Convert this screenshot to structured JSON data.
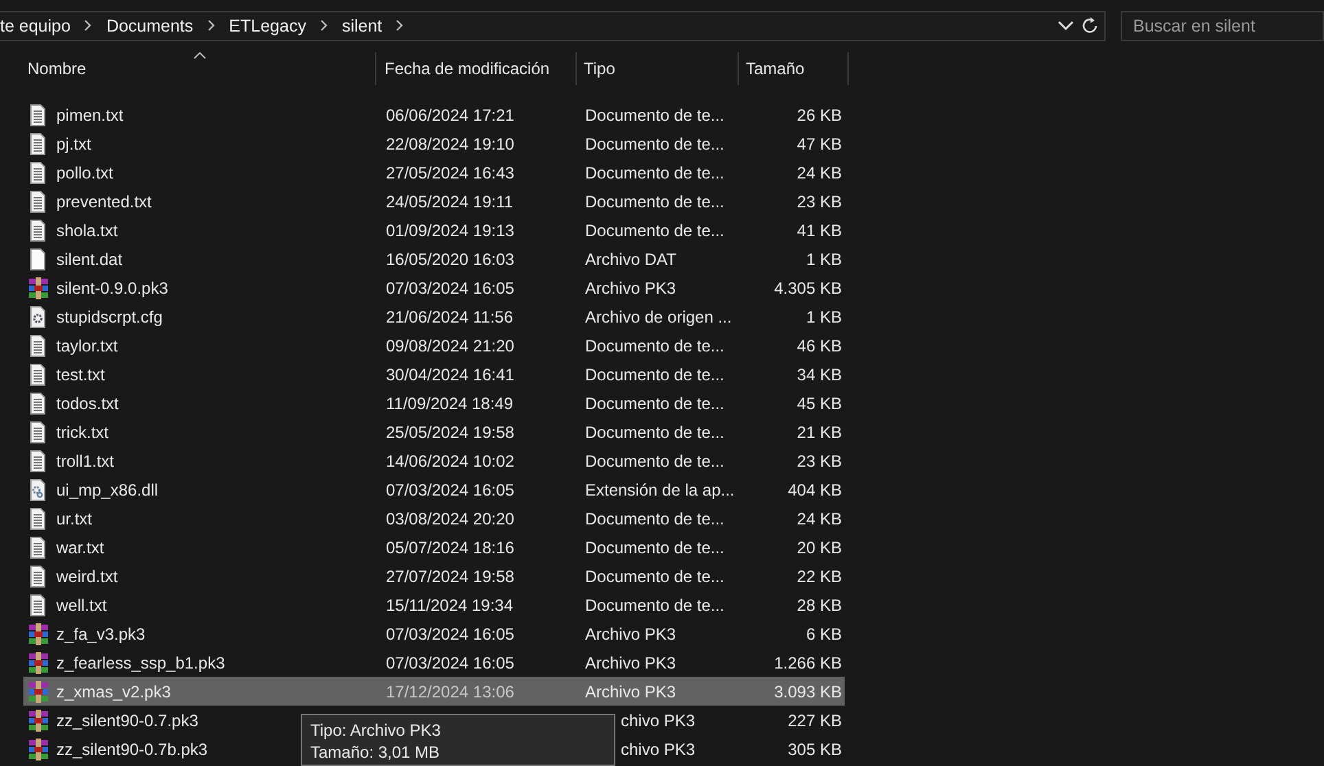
{
  "address_bar": {
    "crumbs": [
      "te equipo",
      "Documents",
      "ETLegacy",
      "silent"
    ]
  },
  "search": {
    "placeholder": "Buscar en silent"
  },
  "table": {
    "columns": [
      {
        "label": "Nombre",
        "sorted": true
      },
      {
        "label": "Fecha de modificación"
      },
      {
        "label": "Tipo"
      },
      {
        "label": "Tamaño"
      }
    ],
    "rows": [
      {
        "kind": "text",
        "name": "pimen.txt",
        "date": "06/06/2024 17:21",
        "type": "Documento de te...",
        "size": "26 KB",
        "selected": false
      },
      {
        "kind": "text",
        "name": "pj.txt",
        "date": "22/08/2024 19:10",
        "type": "Documento de te...",
        "size": "47 KB",
        "selected": false
      },
      {
        "kind": "text",
        "name": "pollo.txt",
        "date": "27/05/2024 16:43",
        "type": "Documento de te...",
        "size": "24 KB",
        "selected": false
      },
      {
        "kind": "text",
        "name": "prevented.txt",
        "date": "24/05/2024 19:11",
        "type": "Documento de te...",
        "size": "23 KB",
        "selected": false
      },
      {
        "kind": "text",
        "name": "shola.txt",
        "date": "01/09/2024 19:13",
        "type": "Documento de te...",
        "size": "41 KB",
        "selected": false
      },
      {
        "kind": "blank",
        "name": "silent.dat",
        "date": "16/05/2020 16:03",
        "type": "Archivo DAT",
        "size": "1 KB",
        "selected": false
      },
      {
        "kind": "archive",
        "name": "silent-0.9.0.pk3",
        "date": "07/03/2024 16:05",
        "type": "Archivo PK3",
        "size": "4.305 KB",
        "selected": false
      },
      {
        "kind": "config",
        "name": "stupidscrpt.cfg",
        "date": "21/06/2024 11:56",
        "type": "Archivo de origen ...",
        "size": "1 KB",
        "selected": false
      },
      {
        "kind": "text",
        "name": "taylor.txt",
        "date": "09/08/2024 21:20",
        "type": "Documento de te...",
        "size": "46 KB",
        "selected": false
      },
      {
        "kind": "text",
        "name": "test.txt",
        "date": "30/04/2024 16:41",
        "type": "Documento de te...",
        "size": "34 KB",
        "selected": false
      },
      {
        "kind": "text",
        "name": "todos.txt",
        "date": "11/09/2024 18:49",
        "type": "Documento de te...",
        "size": "45 KB",
        "selected": false
      },
      {
        "kind": "text",
        "name": "trick.txt",
        "date": "25/05/2024 19:58",
        "type": "Documento de te...",
        "size": "21 KB",
        "selected": false
      },
      {
        "kind": "text",
        "name": "troll1.txt",
        "date": "14/06/2024 10:02",
        "type": "Documento de te...",
        "size": "23 KB",
        "selected": false
      },
      {
        "kind": "library",
        "name": "ui_mp_x86.dll",
        "date": "07/03/2024 16:05",
        "type": "Extensión de la ap...",
        "size": "404 KB",
        "selected": false
      },
      {
        "kind": "text",
        "name": "ur.txt",
        "date": "03/08/2024 20:20",
        "type": "Documento de te...",
        "size": "24 KB",
        "selected": false
      },
      {
        "kind": "text",
        "name": "war.txt",
        "date": "05/07/2024 18:16",
        "type": "Documento de te...",
        "size": "20 KB",
        "selected": false
      },
      {
        "kind": "text",
        "name": "weird.txt",
        "date": "27/07/2024 19:58",
        "type": "Documento de te...",
        "size": "22 KB",
        "selected": false
      },
      {
        "kind": "text",
        "name": "well.txt",
        "date": "15/11/2024 19:34",
        "type": "Documento de te...",
        "size": "28 KB",
        "selected": false
      },
      {
        "kind": "archive",
        "name": "z_fa_v3.pk3",
        "date": "07/03/2024 16:05",
        "type": "Archivo PK3",
        "size": "6 KB",
        "selected": false
      },
      {
        "kind": "archive",
        "name": "z_fearless_ssp_b1.pk3",
        "date": "07/03/2024 16:05",
        "type": "Archivo PK3",
        "size": "1.266 KB",
        "selected": false
      },
      {
        "kind": "archive",
        "name": "z_xmas_v2.pk3",
        "date": "17/12/2024 13:06",
        "type": "Archivo PK3",
        "size": "3.093 KB",
        "selected": true
      },
      {
        "kind": "archive",
        "name": "zz_silent90-0.7.pk3",
        "type": "chivo PK3",
        "type_covered": true,
        "size": "227 KB",
        "selected": false
      },
      {
        "kind": "archive",
        "name": "zz_silent90-0.7b.pk3",
        "type": "chivo PK3",
        "type_covered": true,
        "size": "305 KB",
        "selected": false
      }
    ]
  },
  "tooltip": {
    "lines": [
      "Tipo: Archivo PK3",
      "Tamaño: 3,01 MB"
    ]
  }
}
